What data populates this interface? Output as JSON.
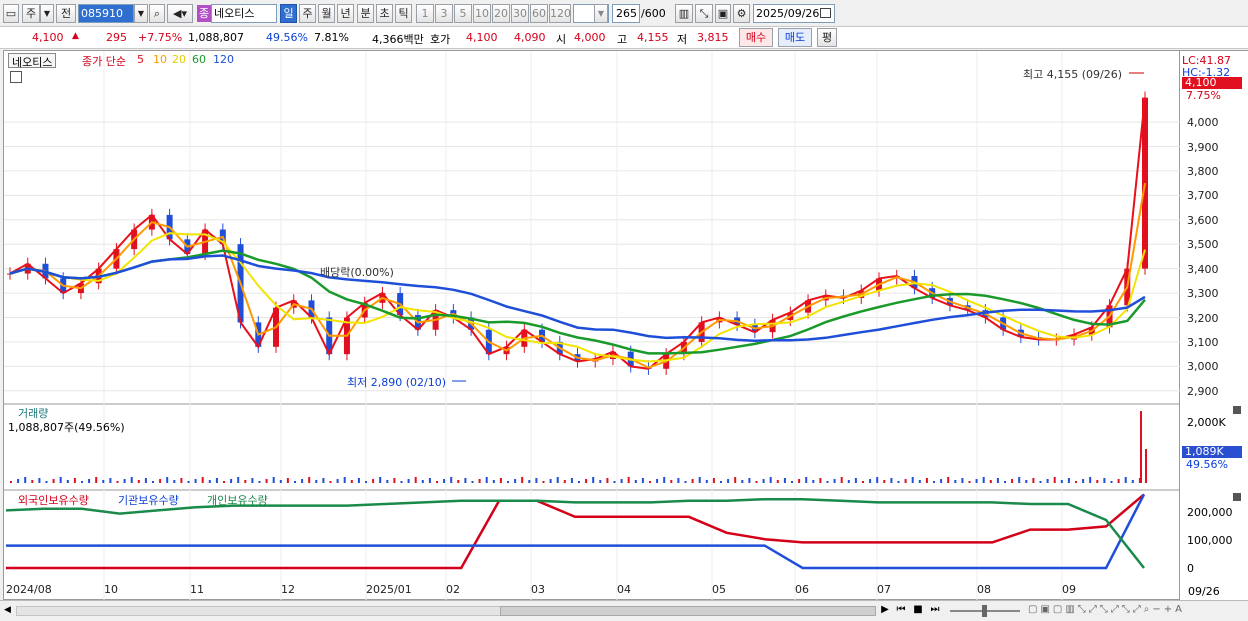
{
  "toolbar": {
    "type_label": "주",
    "prev_label": "전",
    "code": "085910",
    "name_badge": "종",
    "name": "네오티스",
    "periods": [
      "일",
      "주",
      "월",
      "년",
      "분",
      "초",
      "틱"
    ],
    "minutes": [
      "1",
      "3",
      "5",
      "10",
      "20",
      "30",
      "60",
      "120"
    ],
    "count": "265",
    "count_total": "/600",
    "date": "2025/09/26"
  },
  "quote": {
    "price": "4,100",
    "change": "295",
    "change_pct": "+7.75%",
    "volume": "1,088,807",
    "vol_ratio": "49.56%",
    "turnover": "7.81%",
    "amount": "4,366백만",
    "ask_label": "호가",
    "ask": "4,100",
    "bid": "4,090",
    "open_label": "시",
    "open": "4,000",
    "high_label": "고",
    "high": "4,155",
    "low_label": "저",
    "low": "3,815",
    "buy_label": "매수",
    "sell_label": "매도",
    "flat_label": "평"
  },
  "legend": {
    "name": "네오티스",
    "ma_title": "종가 단순",
    "ma": [
      "5",
      "10",
      "20",
      "60",
      "120"
    ],
    "ma_colors": [
      "#e8101a",
      "#ff9a00",
      "#f2e400",
      "#1a9a2a",
      "#1f4fd8"
    ]
  },
  "annotations": {
    "high_label": "최고 4,155 (09/26)",
    "low_label": "최저 2,890 (02/10)",
    "dividend_label": "배당락(0.00%)",
    "lc": "LC:41.87",
    "hc": "HC:-1.32",
    "price_tag": "4,100",
    "pct_tag": "7.75%"
  },
  "volume_panel": {
    "title": "거래량",
    "value": "1,088,807주(49.56%)",
    "tag": "1,089K",
    "tag_pct": "49.56%",
    "axis_label": "2,000K"
  },
  "holding_panel": {
    "legend": [
      "외국인보유수량",
      "기관보유수량",
      "개인보유수량"
    ],
    "colors": [
      "#d4001a",
      "#1f4fd8",
      "#1a8a4a"
    ],
    "ticks": [
      "200,000",
      "100,000",
      "0"
    ]
  },
  "x_axis": [
    "2024/08",
    "10",
    "11",
    "12",
    "2025/01",
    "02",
    "03",
    "04",
    "05",
    "06",
    "07",
    "08",
    "09",
    "09/26"
  ],
  "chart_data": {
    "type": "candlestick",
    "y_ticks": [
      4000,
      3900,
      3800,
      3700,
      3600,
      3500,
      3400,
      3300,
      3200,
      3100,
      3000,
      2900
    ],
    "ylim": [
      2850,
      4250
    ],
    "close_series": [
      3380,
      3420,
      3360,
      3300,
      3340,
      3400,
      3480,
      3560,
      3620,
      3520,
      3460,
      3560,
      3500,
      3180,
      3080,
      3240,
      3270,
      3200,
      3050,
      3200,
      3260,
      3300,
      3210,
      3150,
      3230,
      3200,
      3150,
      3050,
      3080,
      3150,
      3100,
      3050,
      3020,
      3030,
      3060,
      3000,
      2990,
      3050,
      3100,
      3180,
      3200,
      3170,
      3140,
      3190,
      3220,
      3270,
      3290,
      3280,
      3310,
      3360,
      3370,
      3320,
      3280,
      3250,
      3230,
      3200,
      3150,
      3120,
      3110,
      3110,
      3130,
      3160,
      3250,
      3400,
      4100
    ],
    "holdings": {
      "foreign": [
        0,
        0,
        0,
        0,
        0,
        0,
        0,
        0,
        0,
        0,
        0,
        0,
        0,
        210000,
        210000,
        160000,
        160000,
        160000,
        160000,
        110000,
        90000,
        80000,
        80000,
        80000,
        80000,
        80000,
        80000,
        120000,
        120000,
        130000,
        230000
      ],
      "institution": [
        70000,
        70000,
        70000,
        70000,
        70000,
        70000,
        70000,
        70000,
        70000,
        70000,
        70000,
        70000,
        70000,
        70000,
        70000,
        70000,
        70000,
        70000,
        70000,
        70000,
        70000,
        0,
        0,
        0,
        0,
        0,
        0,
        0,
        0,
        0,
        230000
      ],
      "individual": [
        180000,
        185000,
        185000,
        170000,
        180000,
        190000,
        195000,
        195000,
        195000,
        195000,
        200000,
        205000,
        210000,
        210000,
        210000,
        205000,
        205000,
        205000,
        210000,
        210000,
        215000,
        215000,
        210000,
        205000,
        205000,
        205000,
        205000,
        200000,
        200000,
        150000,
        0
      ]
    }
  }
}
